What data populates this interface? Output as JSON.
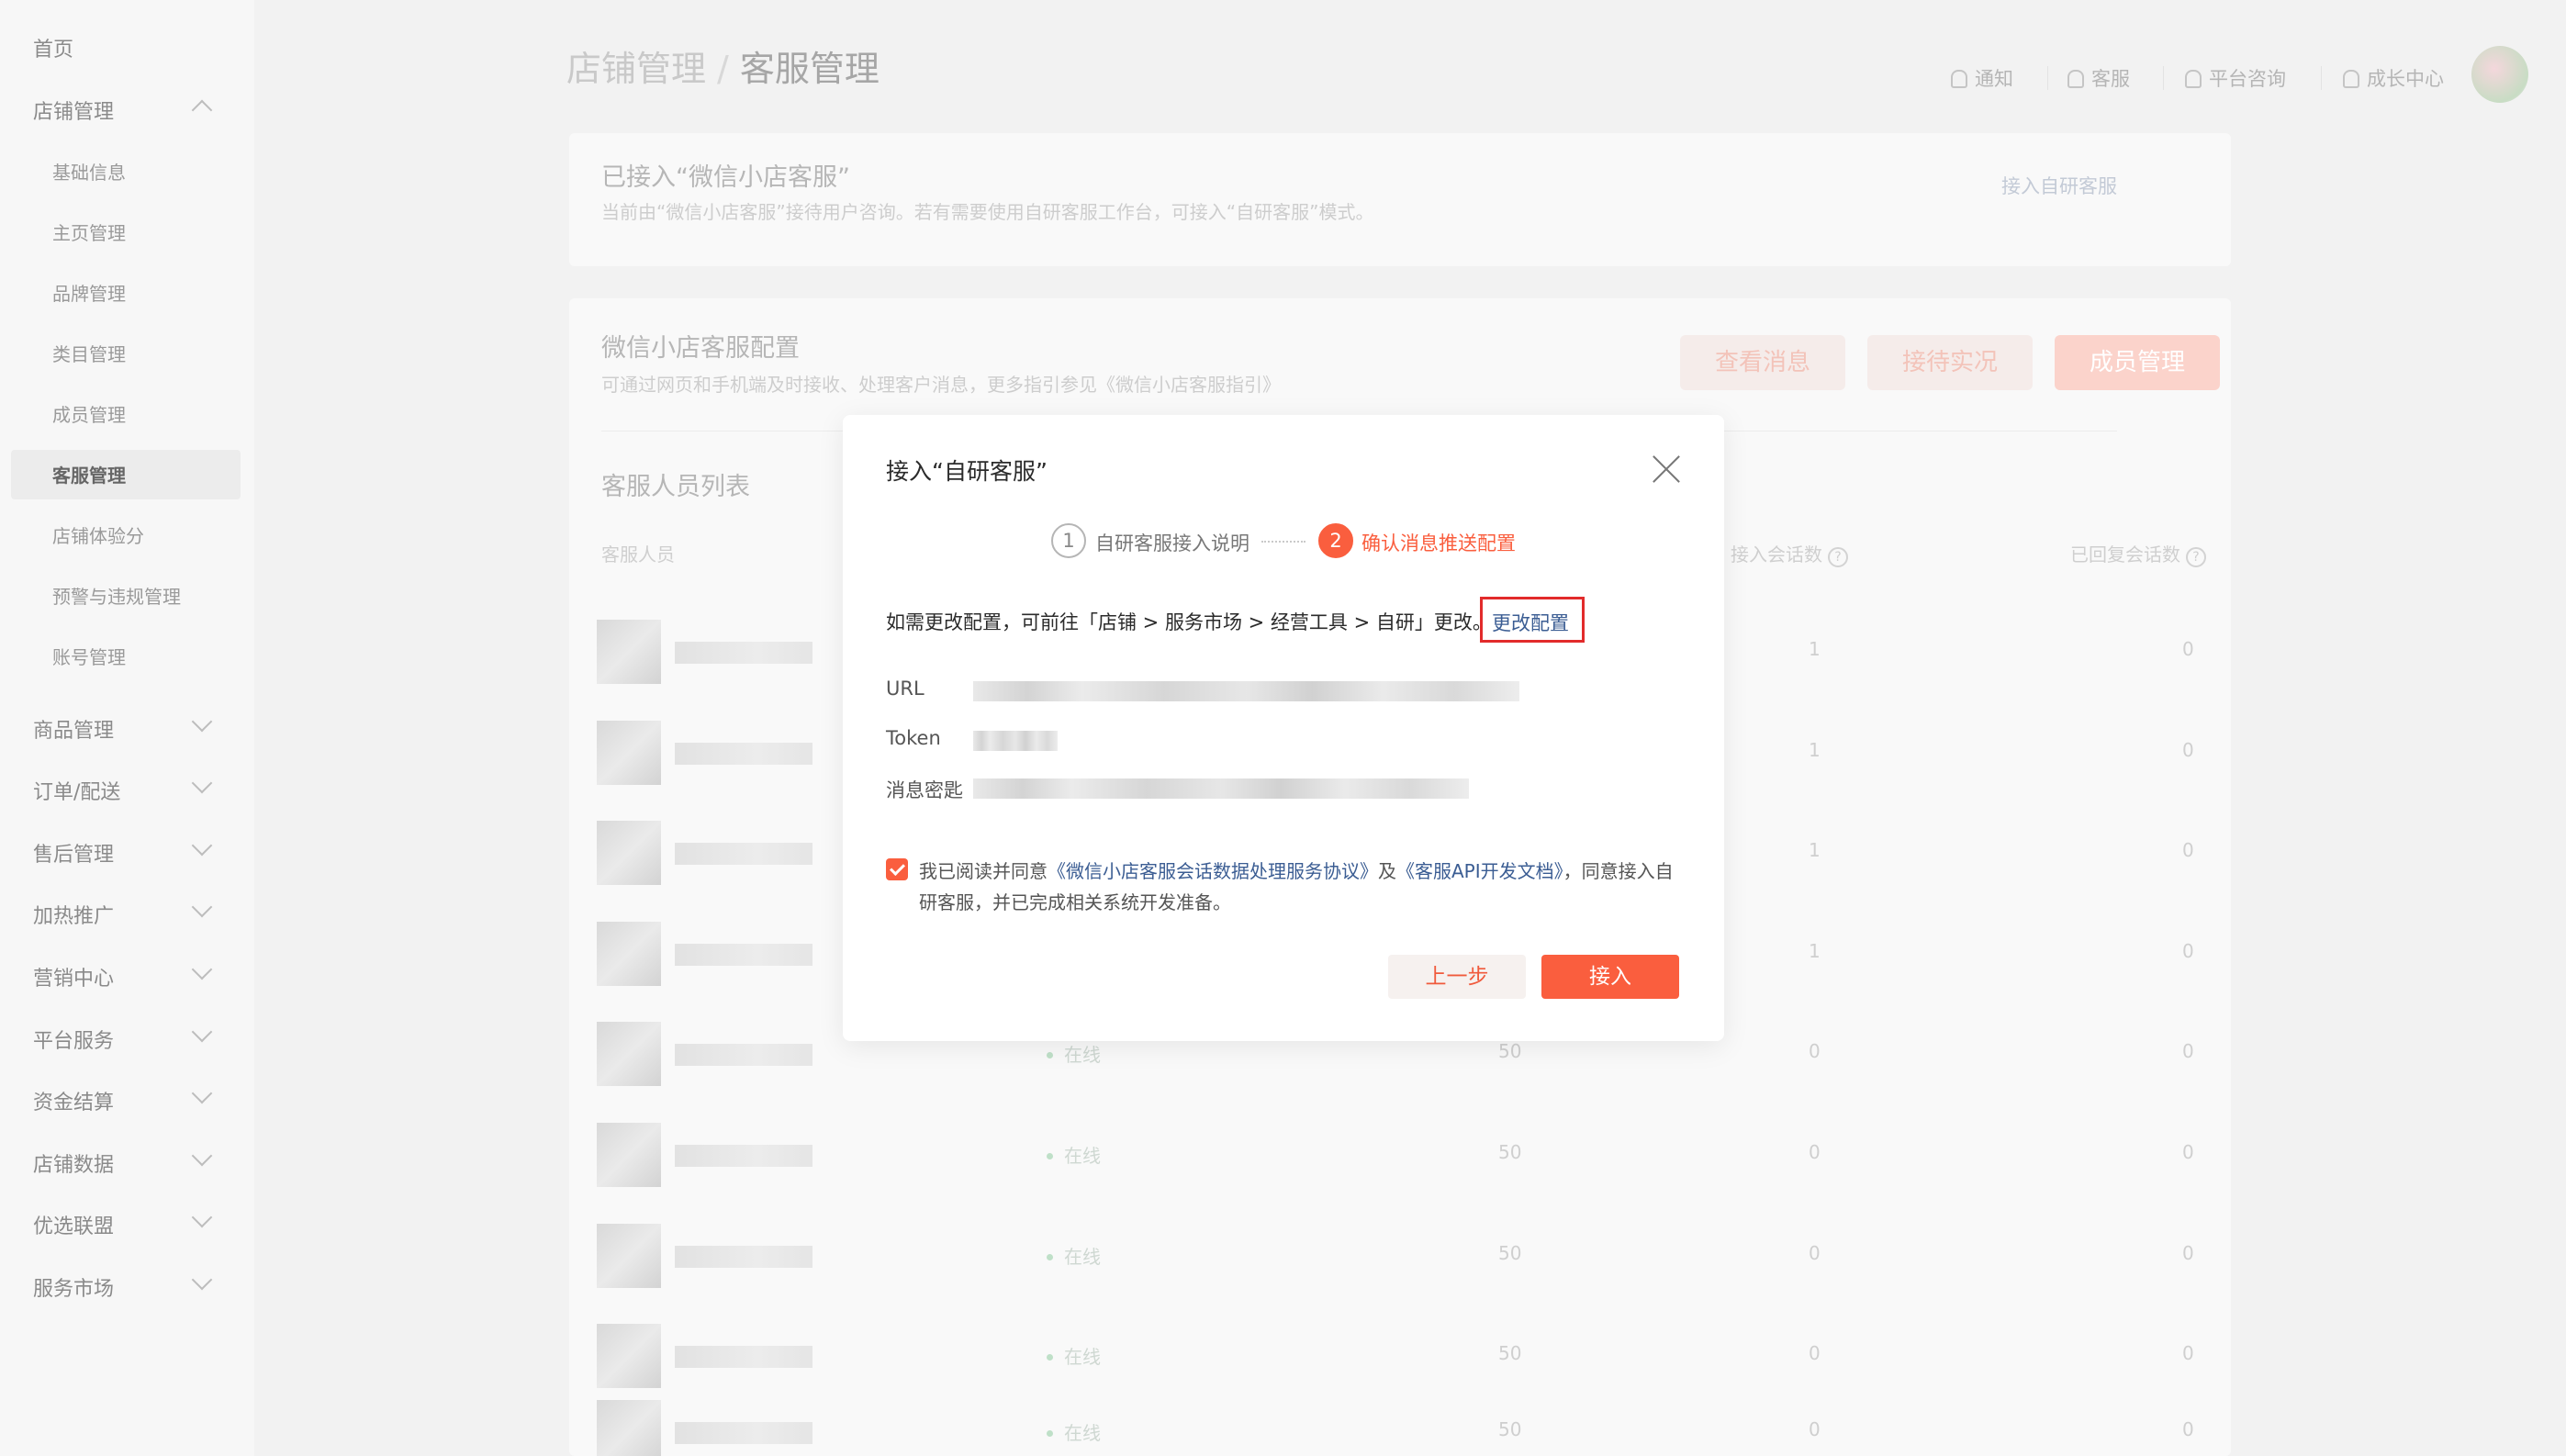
{
  "sidebar": {
    "home": "首页",
    "store_mgmt": "店铺管理",
    "sub_items": [
      "基础信息",
      "主页管理",
      "品牌管理",
      "类目管理",
      "成员管理",
      "客服管理",
      "店铺体验分",
      "预警与违规管理",
      "账号管理"
    ],
    "groups": [
      "商品管理",
      "订单/配送",
      "售后管理",
      "加热推广",
      "营销中心",
      "平台服务",
      "资金结算",
      "店铺数据",
      "优选联盟",
      "服务市场"
    ]
  },
  "header": {
    "breadcrumb_parent": "店铺管理",
    "breadcrumb_sep": "/",
    "breadcrumb_current": "客服管理",
    "nav": [
      "通知",
      "客服",
      "平台咨询",
      "成长中心"
    ]
  },
  "card1": {
    "title": "已接入“微信小店客服”",
    "desc": "当前由“微信小店客服”接待用户咨询。若有需要使用自研客服工作台，可接入“自研客服”模式。",
    "link": "接入自研客服"
  },
  "card2": {
    "title": "微信小店客服配置",
    "desc": "可通过网页和手机端及时接收、处理客户消息，更多指引参见《微信小店客服指引》",
    "buttons": [
      "查看消息",
      "接待实况",
      "成员管理"
    ],
    "list_title": "客服人员列表",
    "columns": [
      "客服人员",
      "接入会话数",
      "已回复会话数"
    ],
    "rows": [
      {
        "status": "",
        "limit": "",
        "sessions": "1",
        "replied": "0"
      },
      {
        "status": "",
        "limit": "",
        "sessions": "1",
        "replied": "0"
      },
      {
        "status": "",
        "limit": "",
        "sessions": "1",
        "replied": "0"
      },
      {
        "status": "",
        "limit": "",
        "sessions": "1",
        "replied": "0"
      },
      {
        "status": "在线",
        "limit": "50",
        "sessions": "0",
        "replied": "0"
      },
      {
        "status": "在线",
        "limit": "50",
        "sessions": "0",
        "replied": "0"
      },
      {
        "status": "在线",
        "limit": "50",
        "sessions": "0",
        "replied": "0"
      },
      {
        "status": "在线",
        "limit": "50",
        "sessions": "0",
        "replied": "0"
      },
      {
        "status": "在线",
        "limit": "50",
        "sessions": "0",
        "replied": "0"
      }
    ]
  },
  "modal": {
    "title": "接入“自研客服”",
    "step1_num": "1",
    "step1_label": "自研客服接入说明",
    "step2_num": "2",
    "step2_label": "确认消息推送配置",
    "note": "如需更改配置，可前往「店铺 > 服务市场 > 经营工具 > 自研」更改。",
    "note_link": "更改配置",
    "field_url": "URL",
    "field_token": "Token",
    "field_key": "消息密匙",
    "agree_prefix": "我已阅读并同意",
    "agree_link1": "《微信小店客服会话数据处理服务协议》",
    "agree_mid": "及",
    "agree_link2": "《客服API开发文档》",
    "agree_suffix": "，同意接入自研客服，并已完成相关系统开发准备。",
    "btn_prev": "上一步",
    "btn_ok": "接入"
  },
  "colors": {
    "accent": "#fa5e3e",
    "link": "#3b5d93",
    "highlight_box": "#e22b2b"
  }
}
